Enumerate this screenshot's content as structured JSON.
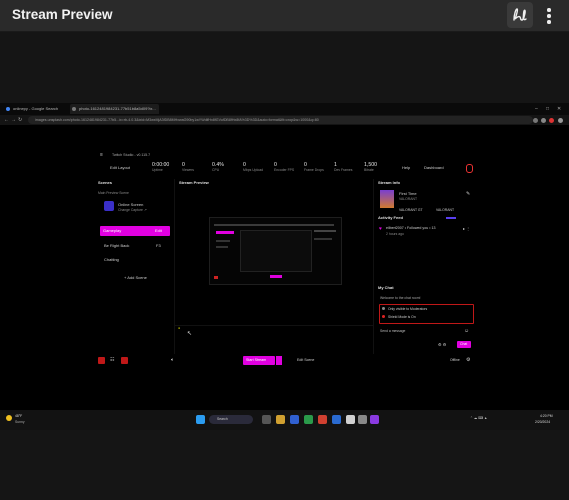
{
  "app": {
    "title": "Stream Preview"
  },
  "browser": {
    "tabs": [
      {
        "title": "onlinepy - Google Search",
        "fav": "#4285f4"
      },
      {
        "title": "photo-1612481984231-77b51b8a5d09?ix...",
        "fav": "#555"
      }
    ],
    "url": "images.unsplash.com/photo-1612481984231-77b5...ix=rb-4.0.3&ixid=M3wxMjA3fDB8MHxwaG90by1wYWdlfHx8fGVufDB8fHx8fA%3D%3D&auto=format&fit=crop&w=1000&q=80"
  },
  "obs": {
    "window_title": "Twitch Studio - v0.115.7",
    "edit_layout": "Edit Layout",
    "stats": [
      {
        "value": "0:00:00",
        "label": "Uptime"
      },
      {
        "value": "0",
        "label": "Viewers"
      },
      {
        "value": "0.4%",
        "label": "CPU"
      },
      {
        "value": "0",
        "label": "Mbps Upload"
      },
      {
        "value": "0",
        "label": "Encoder FPS"
      },
      {
        "value": "0",
        "label": "Frame Drops"
      },
      {
        "value": "1",
        "label": "Dev Frames"
      },
      {
        "value": "1,500",
        "label": "Bitrate"
      }
    ],
    "top_right": {
      "help": "Help",
      "dashboard": "Dashboard"
    },
    "scenes": {
      "title": "Scenes",
      "main_label": "Main Preview Scene",
      "main_name": "Online Screen",
      "main_sub": "Change Capture ↗",
      "items": [
        {
          "label": "Gameplay",
          "right": "Edit",
          "active": true
        },
        {
          "label": "Be Right Back",
          "right": "F3",
          "active": false
        },
        {
          "label": "Chatting",
          "right": "",
          "active": false
        }
      ],
      "add": "+ Add Scene"
    },
    "preview_title": "Stream Preview",
    "info": {
      "title": "Stream Info",
      "stream_title": "First Time",
      "category": "VALORANT",
      "tag1": "VALORANT GT",
      "tag2": "VALORANT",
      "activity_title": "Activity Feed",
      "activity_text": "eilbert2007 • Followed you • 13",
      "activity_time": "2 hours ago",
      "chat_title": "My Chat",
      "chat_welcome": "Welcome to the chat room!",
      "chat_opt1": "Only visible to Moderators",
      "chat_opt2": "Shield Mode is On",
      "chat_placeholder": "Send a message",
      "chat_button": "Chat"
    },
    "bottom": {
      "start": "Start Stream",
      "edit_scene": "Edit Scene",
      "offline": "Offline"
    }
  },
  "taskbar": {
    "weather_temp": "48°F",
    "weather_desc": "Sunny",
    "search": "Search",
    "time": "4:20 PM",
    "date": "2/20/2024"
  },
  "colors": {
    "accent": "#e000e0",
    "header_bg": "#2a2a2a",
    "body_bg": "#151515"
  }
}
